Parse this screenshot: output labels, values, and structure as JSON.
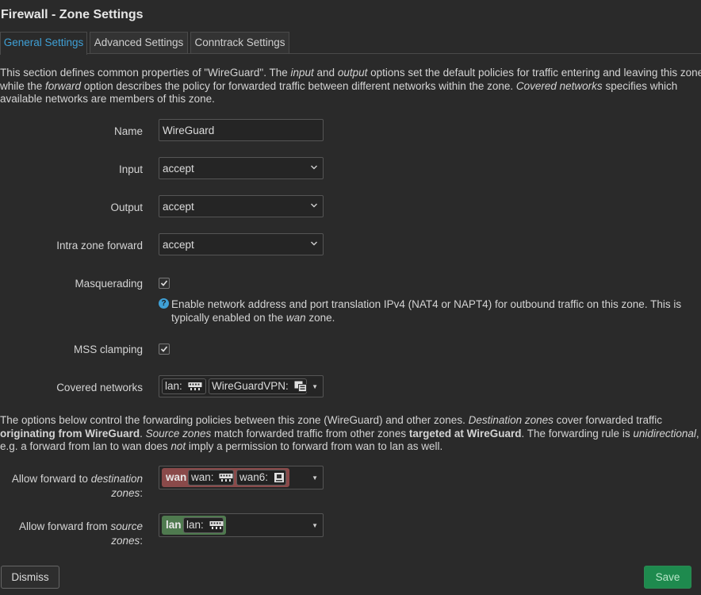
{
  "title": "Firewall - Zone Settings",
  "tabs": [
    {
      "label": "General Settings",
      "active": true
    },
    {
      "label": "Advanced Settings",
      "active": false
    },
    {
      "label": "Conntrack Settings",
      "active": false
    }
  ],
  "intro": {
    "l1a": "This section defines common properties of \"WireGuard\". The ",
    "l1b": "input",
    "l1c": " and ",
    "l1d": "output",
    "l1e": " options set the default policies for traffic entering and leaving this zone",
    "l2a": "while the ",
    "l2b": "forward",
    "l2c": " option describes the policy for forwarded traffic between different networks within the zone. ",
    "l2d": "Covered networks",
    "l2e": " specifies which",
    "l3": "available networks are members of this zone."
  },
  "fields": {
    "name": {
      "label": "Name",
      "value": "WireGuard"
    },
    "input": {
      "label": "Input",
      "value": "accept"
    },
    "output": {
      "label": "Output",
      "value": "accept"
    },
    "intra": {
      "label": "Intra zone forward",
      "value": "accept"
    },
    "masq": {
      "label": "Masquerading",
      "checked": true,
      "help1": "Enable network address and port translation IPv4 (NAT4 or NAPT4) for outbound traffic on this zone. This is",
      "help2a": "typically enabled on the ",
      "help2b": "wan",
      "help2c": " zone."
    },
    "mss": {
      "label": "MSS clamping",
      "checked": true
    },
    "covered": {
      "label": "Covered networks",
      "items": [
        "lan:",
        "WireGuardVPN:"
      ]
    }
  },
  "forwarding_text": {
    "l1a": "The options below control the forwarding policies between this zone (WireGuard) and other zones. ",
    "l1b": "Destination zones",
    "l1c": " cover forwarded traffic",
    "l2a": "originating from WireGuard",
    "l2b": ". ",
    "l2c": "Source zones",
    "l2d": " match forwarded traffic from other zones ",
    "l2e": "targeted at WireGuard",
    "l2f": ". The forwarding rule is ",
    "l2g": "unidirectional",
    "l2h": ",",
    "l3a": "e.g. a forward from lan to wan does ",
    "l3b": "not",
    "l3c": " imply a permission to forward from wan to lan as well."
  },
  "forward_to": {
    "label_a": "Allow forward to ",
    "label_b": "destination",
    "label_c": "zones",
    "label_d": ":",
    "zone": "wan",
    "zone_color": "#8a4a4a",
    "networks": [
      "wan:",
      "wan6:"
    ]
  },
  "forward_from": {
    "label_a": "Allow forward from ",
    "label_b": "source",
    "label_c": "zones",
    "label_d": ":",
    "zone": "lan",
    "zone_color": "#4f7a4f",
    "networks": [
      "lan:"
    ]
  },
  "buttons": {
    "dismiss": "Dismiss",
    "save": "Save"
  }
}
